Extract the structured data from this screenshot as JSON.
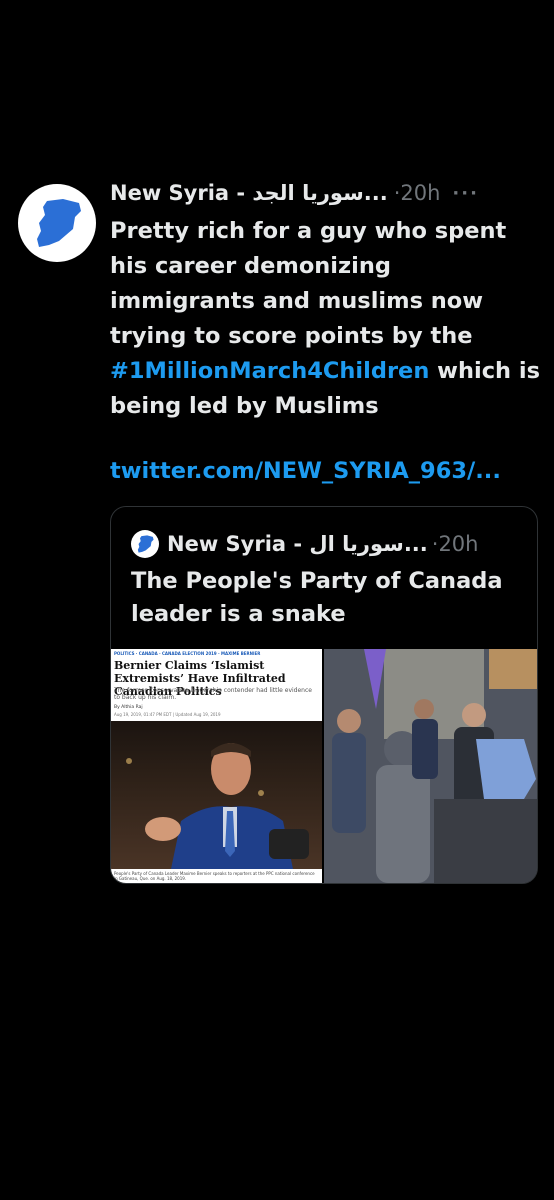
{
  "tweet": {
    "display_name": "New Syria - سوريا الجد...",
    "time": "·20h",
    "more": "···",
    "text_before": "Pretty rich for a guy who spent his career demonizing immigrants and muslims now trying to score points by the ",
    "hashtag": "#1MillionMarch4Children",
    "text_after": " which is being led by Muslims",
    "link": "twitter.com/NEW_SYRIA_963/..."
  },
  "quote": {
    "display_name": "New Syria - سوريا ال...",
    "time": "·20h",
    "text": "The People's Party of Canada leader is a snake"
  },
  "article": {
    "categories": "POLITICS · CANADA · CANADA ELECTION 2019 · MAXIME BERNIER",
    "headline": "Bernier Claims ‘Islamist Extremists’ Have Infiltrated Canadian Politics",
    "subhead": "The former Conservative leadership contender had little evidence to back up his claim.",
    "byline": "By Althia Raj",
    "date": "Aug 19, 2019, 01:47 PM EDT | Updated Aug 19, 2019",
    "caption": "People's Party of Canada Leader Maxime Bernier speaks to reporters at the PPC national conference in Gatineau, Que. on Aug. 18, 2019."
  },
  "colors": {
    "background": "#000000",
    "text": "#e7e9ea",
    "muted": "#71767b",
    "link": "#1d9bf0",
    "border": "#2f3336"
  }
}
